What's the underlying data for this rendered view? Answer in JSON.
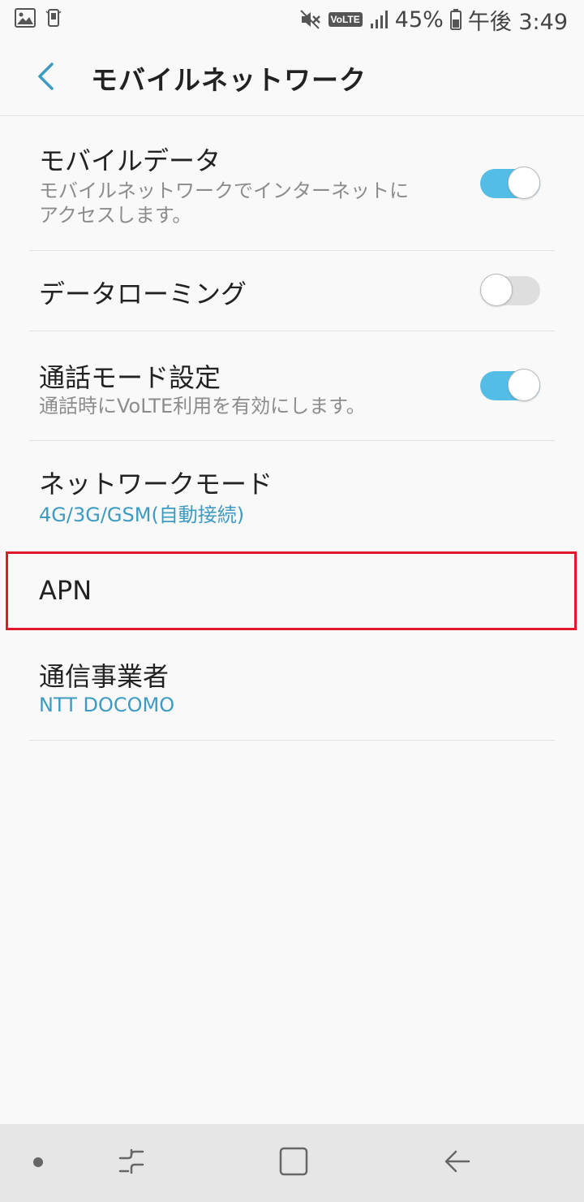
{
  "status_bar": {
    "battery": "45%",
    "time": "午後 3:49",
    "volte": "VoLTE",
    "icons": [
      "gallery-icon",
      "phone-notification-icon",
      "mute-icon",
      "volte-icon",
      "signal-icon",
      "battery-icon"
    ]
  },
  "header": {
    "title": "モバイルネットワーク",
    "back_icon": "chevron-left-icon"
  },
  "settings": {
    "mobile_data": {
      "title": "モバイルデータ",
      "subtitle_line1": "モバイルネットワークでインターネットに",
      "subtitle_line2": "アクセスします。",
      "enabled": true
    },
    "data_roaming": {
      "title": "データローミング",
      "enabled": false
    },
    "call_mode": {
      "title": "通話モード設定",
      "subtitle": "通話時にVoLTE利用を有効にします。",
      "enabled": true
    },
    "network_mode": {
      "title": "ネットワークモード",
      "value": "4G/3G/GSM(自動接続)"
    },
    "apn": {
      "title": "APN"
    },
    "carrier": {
      "title": "通信事業者",
      "value": "NTT DOCOMO"
    }
  },
  "colors": {
    "accent": "#3d9bc1",
    "toggle_on": "#54bde6",
    "highlight": "#e0192b"
  },
  "nav_bar": {
    "icons": [
      "dot-icon",
      "recent-apps-icon",
      "home-icon",
      "back-arrow-icon"
    ]
  }
}
